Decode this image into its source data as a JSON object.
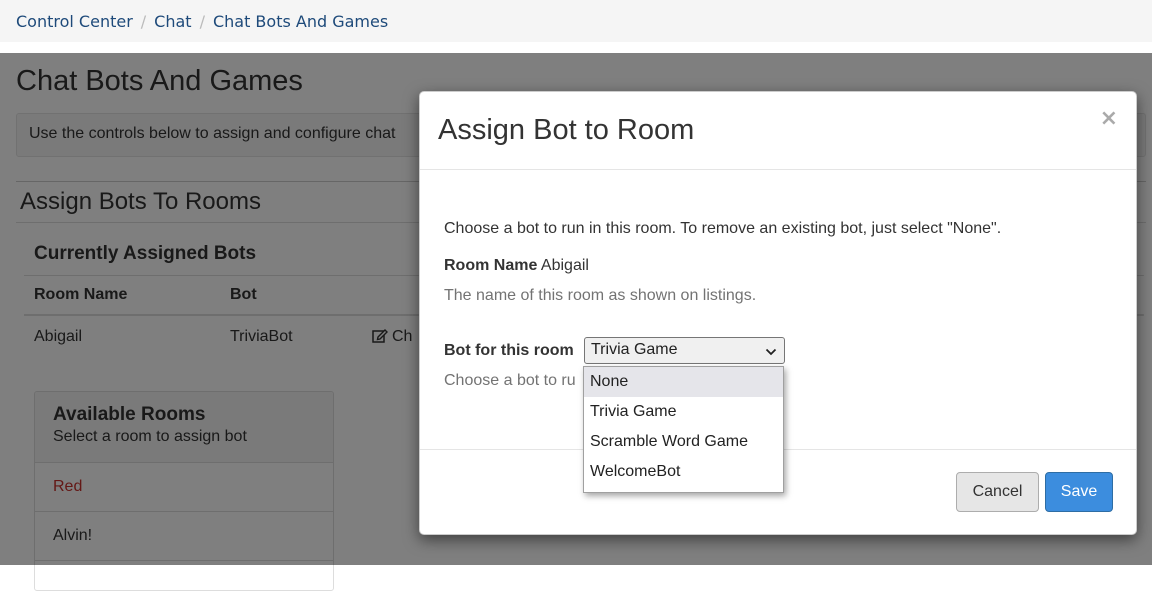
{
  "breadcrumb": {
    "items": [
      "Control Center",
      "Chat",
      "Chat Bots And Games"
    ],
    "separator": "/"
  },
  "page": {
    "title": "Chat Bots And Games",
    "info": "Use the controls below to assign and configure chat",
    "section_title": "Assign Bots To Rooms",
    "assigned": {
      "heading": "Currently Assigned Bots",
      "columns": [
        "Room Name",
        "Bot"
      ],
      "rows": [
        {
          "room": "Abigail",
          "bot": "TriviaBot",
          "action": "Ch"
        }
      ]
    },
    "rooms": {
      "heading": "Available Rooms",
      "subheading": "Select a room to assign bot",
      "items": [
        "Red",
        "Alvin!"
      ]
    }
  },
  "modal": {
    "title": "Assign Bot to Room",
    "close": "×",
    "intro": "Choose a bot to run in this room. To remove an existing bot, just select \"None\".",
    "room_label": "Room Name",
    "room_value": "Abigail",
    "room_help": "The name of this room as shown on listings.",
    "bot_label": "Bot for this room",
    "bot_selected": "Trivia Game",
    "bot_help": "Choose a bot to ru",
    "cancel": "Cancel",
    "save": "Save"
  },
  "dropdown": {
    "options": [
      "None",
      "Trivia Game",
      "Scramble Word Game",
      "WelcomeBot"
    ],
    "highlighted_index": 0
  },
  "colors": {
    "link": "#1e4a7a",
    "primary": "#3c8dde",
    "danger": "#c9302c"
  },
  "icons": {
    "edit": "edit-icon",
    "dropdown": "chevron-down-icon",
    "close": "close-icon"
  }
}
